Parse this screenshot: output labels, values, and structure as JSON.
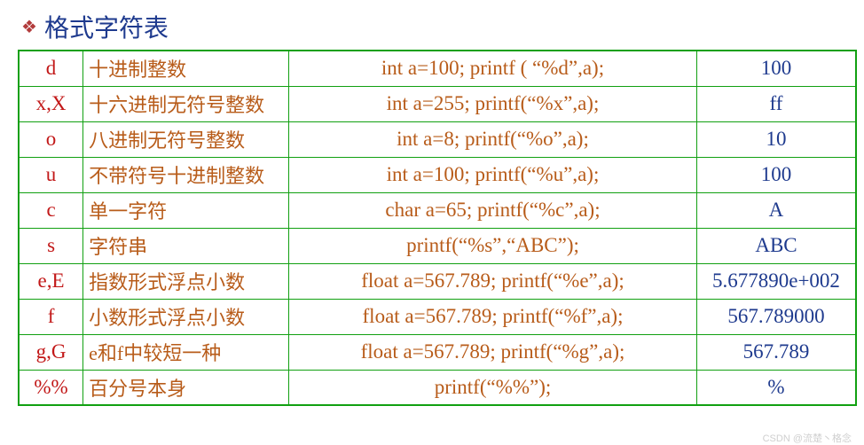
{
  "title": "格式字符表",
  "rows": [
    {
      "fmt": "d",
      "desc": "十进制整数",
      "code": "int a=100;  printf ( “%d”,a);",
      "out": "100"
    },
    {
      "fmt": "x,X",
      "desc": "十六进制无符号整数",
      "code": "int a=255;  printf(“%x”,a);",
      "out": "ff"
    },
    {
      "fmt": "o",
      "desc": "八进制无符号整数",
      "code": "int a=8;  printf(“%o”,a);",
      "out": "10"
    },
    {
      "fmt": "u",
      "desc": "不带符号十进制整数",
      "code": "int a=100;  printf(“%u”,a);",
      "out": "100"
    },
    {
      "fmt": "c",
      "desc": "单一字符",
      "code": "char a=65;  printf(“%c”,a);",
      "out": "A"
    },
    {
      "fmt": "s",
      "desc": "字符串",
      "code": "printf(“%s”,“ABC”);",
      "out": "ABC"
    },
    {
      "fmt": "e,E",
      "desc": "指数形式浮点小数",
      "code": "float a=567.789;  printf(“%e”,a);",
      "out": "5.677890e+002"
    },
    {
      "fmt": "f",
      "desc": "小数形式浮点小数",
      "code": "float a=567.789;  printf(“%f”,a);",
      "out": "567.789000"
    },
    {
      "fmt": "g,G",
      "desc": "e和f中较短一种",
      "code": "float a=567.789;  printf(“%g”,a);",
      "out": "567.789"
    },
    {
      "fmt": "%%",
      "desc": "百分号本身",
      "code": "printf(“%%”);",
      "out": "%"
    }
  ],
  "watermark": "CSDN @流楚丶格念"
}
